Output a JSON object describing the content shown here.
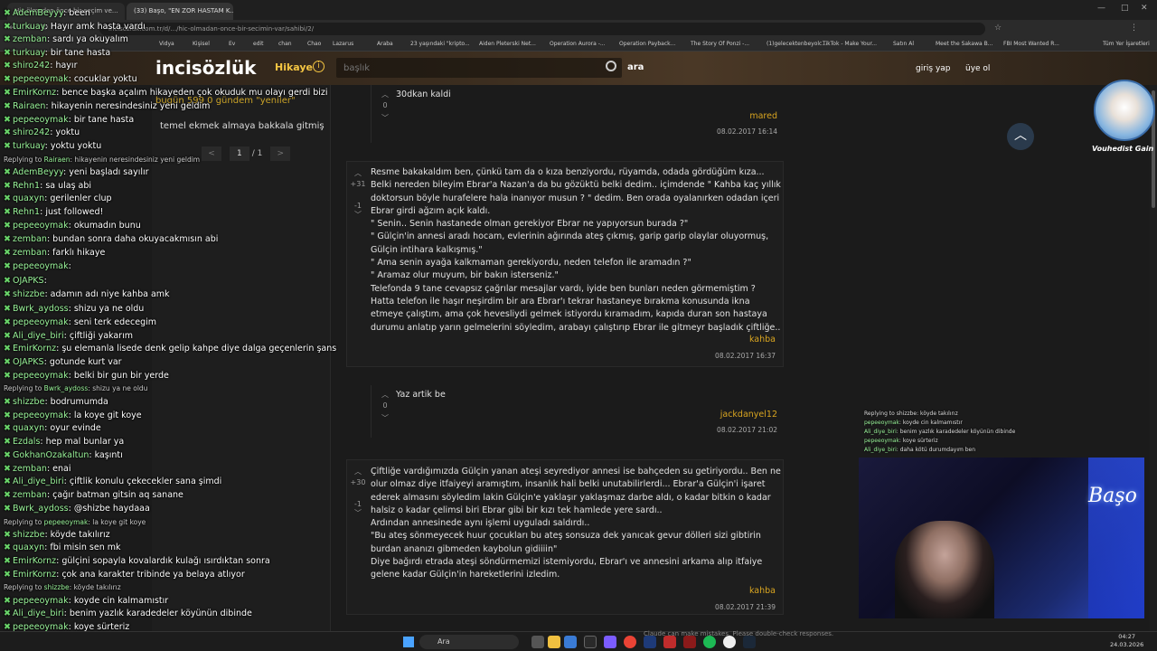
{
  "browser": {
    "tabs": [
      "Hiç ölmeden önce bir seçim ve...",
      "(33) Başo, \"EN ZOR HASTAM K..."
    ],
    "url": "incisozluk.com.tr/d/.../hic-olmadan-once-bir-secimin-var/sahibi/2/",
    "bookmarks": [
      "Vidya",
      "Kişisel",
      "Ev",
      "edit",
      "chan",
      "Chao",
      "Lazarus",
      "Araba",
      "23 yaşındaki \"kripto...",
      "Aiden Pleterski Net...",
      "Operation Aurora -...",
      "Operation Payback...",
      "The Story Of Ponzi -...",
      "(1)gelecektenbeyolc...",
      "TikTok - Make Your...",
      "Satın Al",
      "Meet the Sakawa B...",
      "FBI Most Wanted R...",
      "Tüm Yer İşaretleri"
    ]
  },
  "site": {
    "logo": "incisözlük",
    "nav_hikaye": "Hikaye",
    "search_placeholder": "başlık",
    "search_button": "ara",
    "login": "giriş yap",
    "register": "üye ol"
  },
  "left_panel": {
    "gundem": "bugün 599  0  gündem \"yeniler\"",
    "topic": "temel ekmek almaya bakkala gitmiş",
    "page_current": "1",
    "page_total": "/ 1",
    "prev": "<",
    "next": ">"
  },
  "entries": [
    {
      "score_up": "",
      "score": "0",
      "text": "30dkan kaldi",
      "author": "mared",
      "date": "08.02.2017 16:14"
    },
    {
      "score_up": "+31",
      "score": "-1",
      "text": "Resme bakakaldım ben, çünkü tam da o kıza benziyordu, rüyamda, odada gördüğüm kıza... Belki nereden bileyim Ebrar'a Nazan'a da bu gözüktü belki dedim.. içimdende \" Kahba kaç yıllık doktorsun böyle hurafelere hala inanıyor musun ? \" dedim. Ben orada oyalanırken odadan içeri Ebrar girdi ağzım açık kaldı.\n\" Senin.. Senin hastanede olman gerekiyor Ebrar ne yapıyorsun burada ?\"\n\" Gülçin'in annesi aradı hocam, evlerinin ağırında ateş çıkmış, garip garip olaylar oluyormuş, Gülçin intihara kalkışmış.\"\n\" Ama senin ayağa kalkmaman gerekiyordu, neden telefon ile aramadın ?\"\n\" Aramaz olur muyum, bir bakın isterseniz.\"\nTelefonda 9 tane cevapsız çağrılar mesajlar vardı, iyide ben bunları neden görmemiştim ? Hatta telefon ile haşır neşirdim bir ara Ebrar'ı tekrar hastaneye bırakma konusunda ikna etmeye çalıştım, ama çok hevesliydi gelmek istiyordu kıramadım, kapıda duran son hastaya durumu anlatıp yarın gelmelerini söyledim, arabayı çalıştırıp Ebrar ile gitmeyr başladık çiftliğe..",
      "author": "kahba",
      "date": "08.02.2017 16:37"
    },
    {
      "score_up": "",
      "score": "0",
      "text": "Yaz artik be",
      "author": "jackdanyel12",
      "date": "08.02.2017 21:02"
    },
    {
      "score_up": "+30",
      "score": "-1",
      "text": "Çiftliğe vardığımızda Gülçin yanan ateşi seyrediyor annesi ise bahçeden su getiriyordu.. Ben ne olur olmaz diye itfaiyeyi aramıştım, insanlık hali belki unutabilirlerdi... Ebrar'a Gülçin'i işaret ederek almasını söyledim lakin Gülçin'e yaklaşır yaklaşmaz darbe aldı, o kadar bitkin o kadar halsiz o kadar çelimsi biri Ebrar gibi bir kızı tek hamlede yere sardı..\nArdından annesinede aynı işlemi uyguladı saldırdı..\n\"Bu ateş sönmeyecek huur çocukları bu ateş sonsuza dek yanıcak gevur dölleri sizi gibtirin burdan ananızı gibmeden kaybolun gidiiiin\"\nDiye bağırdı etrada ateşi söndürmemizi istemiyordu, Ebrar'ı ve annesini arkama alıp itfaiye gelene kadar Gülçin'in hareketlerini izledim.",
      "author": "kahba",
      "date": "08.02.2017 21:39"
    }
  ],
  "chat": [
    {
      "type": "msg",
      "user": "AdemBeyyy",
      "text": "been"
    },
    {
      "type": "msg",
      "user": "turkuay",
      "text": "Hayır amk hasta vardı"
    },
    {
      "type": "msg",
      "user": "zemban",
      "text": "sardı ya okuyalım"
    },
    {
      "type": "msg",
      "user": "turkuay",
      "text": "bir tane hasta"
    },
    {
      "type": "msg",
      "user": "shiro242",
      "text": "hayır"
    },
    {
      "type": "msg",
      "user": "pepeeoymak",
      "text": "cocuklar yoktu"
    },
    {
      "type": "msg",
      "user": "EmirKornz",
      "text": "bence başka açalım hikayeden çok okuduk mu olayı gerdi bizi"
    },
    {
      "type": "msg",
      "user": "Rairaen",
      "text": "hikayenin neresindesiniz yeni geldim"
    },
    {
      "type": "msg",
      "user": "pepeeoymak",
      "text": "bir tane hasta"
    },
    {
      "type": "msg",
      "user": "shiro242",
      "text": "yoktu"
    },
    {
      "type": "msg",
      "user": "turkuay",
      "text": "yoktu yoktu"
    },
    {
      "type": "reply",
      "user": "Rairaen",
      "text": "hikayenin neresindesiniz yeni geldim"
    },
    {
      "type": "msg",
      "user": "AdemBeyyy",
      "text": "yeni başladı sayılır"
    },
    {
      "type": "msg",
      "user": "Rehn1",
      "text": "sa ulaş abi"
    },
    {
      "type": "msg",
      "user": "quaxyn",
      "text": "gerilenler clup"
    },
    {
      "type": "msg",
      "user": "Rehn1",
      "text": "just followed!"
    },
    {
      "type": "msg",
      "user": "pepeeoymak",
      "text": "okumadın bunu"
    },
    {
      "type": "msg",
      "user": "zemban",
      "text": "bundan sonra daha okuyacakmısın abi"
    },
    {
      "type": "msg",
      "user": "zemban",
      "text": "farklı hikaye"
    },
    {
      "type": "msg",
      "user": "pepeeoymak",
      "text": ""
    },
    {
      "type": "msg",
      "user": "OJAPKS",
      "text": ""
    },
    {
      "type": "msg",
      "user": "shizzbe",
      "text": "adamın adı niye kahba amk"
    },
    {
      "type": "msg",
      "user": "Bwrk_aydoss",
      "text": "shizu ya ne oldu"
    },
    {
      "type": "msg",
      "user": "pepeeoymak",
      "text": "seni terk edecegim"
    },
    {
      "type": "msg",
      "user": "Ali_diye_biri",
      "text": "çiftliği yakarım"
    },
    {
      "type": "msg",
      "user": "EmirKornz",
      "text": "şu elemanla lisede denk gelip kahpe diye dalga geçenlerin şans"
    },
    {
      "type": "msg",
      "user": "OJAPKS",
      "text": "gotunde kurt var"
    },
    {
      "type": "msg",
      "user": "pepeeoymak",
      "text": "belki bir gun bir yerde"
    },
    {
      "type": "reply",
      "user": "Bwrk_aydoss",
      "text": "shizu ya ne oldu"
    },
    {
      "type": "msg",
      "user": "shizzbe",
      "text": "bodrumumda"
    },
    {
      "type": "msg",
      "user": "pepeeoymak",
      "text": "la koye git koye"
    },
    {
      "type": "msg",
      "user": "quaxyn",
      "text": "oyur evinde"
    },
    {
      "type": "msg",
      "user": "Ezdals",
      "text": "hep mal bunlar ya"
    },
    {
      "type": "msg",
      "user": "GokhanOzakaltun",
      "text": "kaşıntı"
    },
    {
      "type": "msg",
      "user": "zemban",
      "text": "enai"
    },
    {
      "type": "msg",
      "user": "Ali_diye_biri",
      "text": "çiftlik konulu çekecekler sana şimdi"
    },
    {
      "type": "msg",
      "user": "zemban",
      "text": "çağır batman gitsin aq sanane"
    },
    {
      "type": "msg",
      "user": "Bwrk_aydoss",
      "text": "@shizbe haydaaa"
    },
    {
      "type": "reply",
      "user": "pepeeoymak",
      "text": "la koye git koye"
    },
    {
      "type": "msg",
      "user": "shizzbe",
      "text": "köyde takılırız"
    },
    {
      "type": "msg",
      "user": "quaxyn",
      "text": "fbi misin sen mk"
    },
    {
      "type": "msg",
      "user": "EmirKornz",
      "text": "gülçini sopayla kovalardık kulağı ısırdıktan sonra"
    },
    {
      "type": "msg",
      "user": "EmirKornz",
      "text": "çok ana karakter tribinde ya belaya atlıyor"
    },
    {
      "type": "reply",
      "user": "shizzbe",
      "text": "köyde takılırız"
    },
    {
      "type": "msg",
      "user": "pepeeoymak",
      "text": "koyde cin kalmamıstır"
    },
    {
      "type": "msg",
      "user": "Ali_diye_biri",
      "text": "benim yazlık karadedeler köyünün dibinde"
    },
    {
      "type": "msg",
      "user": "pepeeoymak",
      "text": "koye sürteriz"
    },
    {
      "type": "msg",
      "user": "Ali_diye_biri",
      "text": "daha kötü durumdayım ben"
    }
  ],
  "mini_chat": [
    {
      "user": "",
      "text": "Replying to shizzbe: köyde takılırız"
    },
    {
      "user": "pepeeoymak",
      "text": "koyde cin kalmamıstır"
    },
    {
      "user": "Ali_diye_biri",
      "text": "benim yazlık karadedeler köyünün dibinde"
    },
    {
      "user": "pepeeoymak",
      "text": "koye sürteriz"
    },
    {
      "user": "Ali_diye_biri",
      "text": "daha kötü durumdayım ben"
    }
  ],
  "stream": {
    "sign": "Başo",
    "avatar_name": "Vouhedist Gain"
  },
  "taskbar": {
    "search": "Ara",
    "disclaimer": "Claude can make mistakes. Please double-check responses.",
    "time": "04:27",
    "date": "24.03.2026"
  }
}
